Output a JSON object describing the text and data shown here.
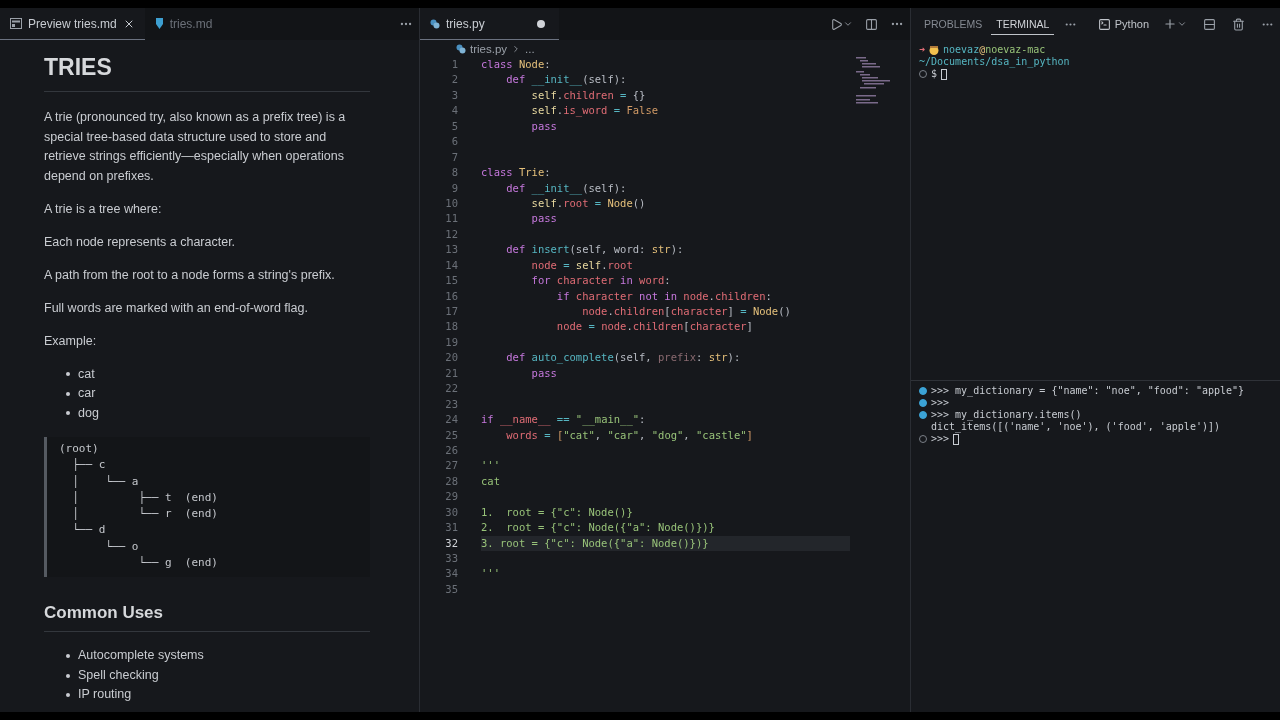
{
  "preview_tabs": [
    {
      "label": "Preview tries.md",
      "selected": true,
      "closable": true
    },
    {
      "label": "tries.md",
      "selected": false,
      "closable": false
    }
  ],
  "preview": {
    "blocks": [
      {
        "kind": "h1",
        "text": "TRIES"
      },
      {
        "kind": "p",
        "text": "A trie (pronounced try, also known as a prefix tree) is a special tree-based data structure used to store and retrieve strings efficiently—especially when operations depend on prefixes."
      },
      {
        "kind": "p",
        "text": "A trie is a tree where:"
      },
      {
        "kind": "p",
        "text": "Each node represents a character."
      },
      {
        "kind": "p",
        "text": "A path from the root to a node forms a string's prefix."
      },
      {
        "kind": "p",
        "text": "Full words are marked with an end-of-word flag."
      },
      {
        "kind": "p",
        "text": "Example:"
      },
      {
        "kind": "ul",
        "items": [
          "cat",
          "car",
          "dog"
        ]
      },
      {
        "kind": "pre",
        "lines": [
          "(root)",
          "  ├── c",
          "  │    └── a",
          "  │         ├── t  (end)",
          "  │         └── r  (end)",
          "  └── d",
          "       └── o",
          "            └── g  (end)"
        ]
      },
      {
        "kind": "h2",
        "text": "Common Uses"
      },
      {
        "kind": "ul",
        "items": [
          "Autocomplete systems",
          "Spell checking",
          "IP routing"
        ]
      }
    ]
  },
  "editor": {
    "tab": {
      "label": "tries.py",
      "modified": true,
      "selected": true
    },
    "breadcrumb": [
      "tries.py",
      "..."
    ],
    "lines": [
      {
        "n": "1",
        "selected": false,
        "tokens": [
          {
            "text": "class ",
            "kind": "kw"
          },
          {
            "text": "Node",
            "kind": "cls"
          },
          {
            "text": ":",
            "kind": "plain"
          }
        ]
      },
      {
        "n": "2",
        "selected": false,
        "tokens": [
          {
            "text": "    def ",
            "kind": "kw"
          },
          {
            "text": "__init__",
            "kind": "fn"
          },
          {
            "text": "(self):",
            "kind": "plain"
          }
        ]
      },
      {
        "n": "3",
        "selected": false,
        "tokens": [
          {
            "text": "        self",
            "kind": "self"
          },
          {
            "text": ".",
            "kind": "plain"
          },
          {
            "text": "children",
            "kind": "attr"
          },
          {
            "text": " = ",
            "kind": "op"
          },
          {
            "text": "{}",
            "kind": "plain"
          }
        ]
      },
      {
        "n": "4",
        "selected": false,
        "tokens": [
          {
            "text": "        self",
            "kind": "self"
          },
          {
            "text": ".",
            "kind": "plain"
          },
          {
            "text": "is_word",
            "kind": "attr"
          },
          {
            "text": " = ",
            "kind": "op"
          },
          {
            "text": "False",
            "kind": "num"
          }
        ]
      },
      {
        "n": "5",
        "selected": false,
        "tokens": [
          {
            "text": "        pass",
            "kind": "kw"
          }
        ]
      },
      {
        "n": "6",
        "selected": false
      },
      {
        "n": "7",
        "selected": false
      },
      {
        "n": "8",
        "selected": false,
        "tokens": [
          {
            "text": "class ",
            "kind": "kw"
          },
          {
            "text": "Trie",
            "kind": "cls"
          },
          {
            "text": ":",
            "kind": "plain"
          }
        ]
      },
      {
        "n": "9",
        "selected": false,
        "tokens": [
          {
            "text": "    def ",
            "kind": "kw"
          },
          {
            "text": "__init__",
            "kind": "fn"
          },
          {
            "text": "(self):",
            "kind": "plain"
          }
        ]
      },
      {
        "n": "10",
        "selected": false,
        "tokens": [
          {
            "text": "        self",
            "kind": "self"
          },
          {
            "text": ".",
            "kind": "plain"
          },
          {
            "text": "root",
            "kind": "attr"
          },
          {
            "text": " = ",
            "kind": "op"
          },
          {
            "text": "Node",
            "kind": "cls"
          },
          {
            "text": "()",
            "kind": "plain"
          }
        ]
      },
      {
        "n": "11",
        "selected": false,
        "tokens": [
          {
            "text": "        pass",
            "kind": "kw"
          }
        ]
      },
      {
        "n": "12",
        "selected": false
      },
      {
        "n": "13",
        "selected": false,
        "tokens": [
          {
            "text": "    def ",
            "kind": "kw"
          },
          {
            "text": "insert",
            "kind": "fn"
          },
          {
            "text": "(self, word: ",
            "kind": "plain"
          },
          {
            "text": "str",
            "kind": "cls"
          },
          {
            "text": "):",
            "kind": "plain"
          }
        ]
      },
      {
        "n": "14",
        "selected": false,
        "tokens": [
          {
            "text": "        node",
            "kind": "attr"
          },
          {
            "text": " = ",
            "kind": "op"
          },
          {
            "text": "self",
            "kind": "self"
          },
          {
            "text": ".",
            "kind": "plain"
          },
          {
            "text": "root",
            "kind": "attr"
          }
        ]
      },
      {
        "n": "15",
        "selected": false,
        "tokens": [
          {
            "text": "        for ",
            "kind": "kw"
          },
          {
            "text": "character",
            "kind": "attr"
          },
          {
            "text": " in ",
            "kind": "kw"
          },
          {
            "text": "word",
            "kind": "attr"
          },
          {
            "text": ":",
            "kind": "plain"
          }
        ]
      },
      {
        "n": "16",
        "selected": false,
        "tokens": [
          {
            "text": "            if ",
            "kind": "kw"
          },
          {
            "text": "character",
            "kind": "attr"
          },
          {
            "text": " not in ",
            "kind": "kw"
          },
          {
            "text": "node",
            "kind": "attr"
          },
          {
            "text": ".",
            "kind": "plain"
          },
          {
            "text": "children",
            "kind": "attr"
          },
          {
            "text": ":",
            "kind": "plain"
          }
        ]
      },
      {
        "n": "17",
        "selected": false,
        "tokens": [
          {
            "text": "                node",
            "kind": "attr"
          },
          {
            "text": ".",
            "kind": "plain"
          },
          {
            "text": "children",
            "kind": "attr"
          },
          {
            "text": "[",
            "kind": "plain"
          },
          {
            "text": "character",
            "kind": "attr"
          },
          {
            "text": "] ",
            "kind": "plain"
          },
          {
            "text": "= ",
            "kind": "op"
          },
          {
            "text": "Node",
            "kind": "cls"
          },
          {
            "text": "()",
            "kind": "plain"
          }
        ]
      },
      {
        "n": "18",
        "selected": false,
        "tokens": [
          {
            "text": "            node",
            "kind": "attr"
          },
          {
            "text": " = ",
            "kind": "op"
          },
          {
            "text": "node",
            "kind": "attr"
          },
          {
            "text": ".",
            "kind": "plain"
          },
          {
            "text": "children",
            "kind": "attr"
          },
          {
            "text": "[",
            "kind": "plain"
          },
          {
            "text": "character",
            "kind": "attr"
          },
          {
            "text": "]",
            "kind": "plain"
          }
        ]
      },
      {
        "n": "19",
        "selected": false
      },
      {
        "n": "20",
        "selected": false,
        "tokens": [
          {
            "text": "    def ",
            "kind": "kw"
          },
          {
            "text": "auto_complete",
            "kind": "fn"
          },
          {
            "text": "(self, ",
            "kind": "plain"
          },
          {
            "text": "prefix",
            "kind": "unused"
          },
          {
            "text": ": ",
            "kind": "plain"
          },
          {
            "text": "str",
            "kind": "cls"
          },
          {
            "text": "):",
            "kind": "plain"
          }
        ]
      },
      {
        "n": "21",
        "selected": false,
        "tokens": [
          {
            "text": "        pass",
            "kind": "kw"
          }
        ]
      },
      {
        "n": "22",
        "selected": false
      },
      {
        "n": "23",
        "selected": false
      },
      {
        "n": "24",
        "selected": false,
        "tokens": [
          {
            "text": "if ",
            "kind": "kw"
          },
          {
            "text": "__name__",
            "kind": "attr"
          },
          {
            "text": " == ",
            "kind": "op"
          },
          {
            "text": "\"__main__\"",
            "kind": "str"
          },
          {
            "text": ":",
            "kind": "plain"
          }
        ]
      },
      {
        "n": "25",
        "selected": false,
        "tokens": [
          {
            "text": "    words",
            "kind": "attr"
          },
          {
            "text": " = ",
            "kind": "op"
          },
          {
            "text": "[",
            "kind": "num"
          },
          {
            "text": "\"cat\"",
            "kind": "str"
          },
          {
            "text": ", ",
            "kind": "plain"
          },
          {
            "text": "\"car\"",
            "kind": "str"
          },
          {
            "text": ", ",
            "kind": "plain"
          },
          {
            "text": "\"dog\"",
            "kind": "str"
          },
          {
            "text": ", ",
            "kind": "plain"
          },
          {
            "text": "\"castle\"",
            "kind": "str"
          },
          {
            "text": "]",
            "kind": "num"
          }
        ]
      },
      {
        "n": "26",
        "selected": false
      },
      {
        "n": "27",
        "selected": false,
        "tokens": [
          {
            "text": "'''",
            "kind": "str"
          }
        ]
      },
      {
        "n": "28",
        "selected": false,
        "tokens": [
          {
            "text": "cat",
            "kind": "str"
          }
        ]
      },
      {
        "n": "29",
        "selected": false
      },
      {
        "n": "30",
        "selected": false,
        "tokens": [
          {
            "text": "1.  root = {\"c\": Node()}",
            "kind": "str"
          }
        ]
      },
      {
        "n": "31",
        "selected": false,
        "tokens": [
          {
            "text": "2.  root = {\"c\": Node({\"a\": Node()})}",
            "kind": "str"
          }
        ]
      },
      {
        "n": "32",
        "selected": true,
        "tokens": [
          {
            "text": "3. root = {\"c\": Node({\"a\": Node()})}",
            "kind": "str"
          }
        ]
      },
      {
        "n": "33",
        "selected": false
      },
      {
        "n": "34",
        "selected": false,
        "tokens": [
          {
            "text": "'''",
            "kind": "str"
          }
        ]
      },
      {
        "n": "35",
        "selected": false
      }
    ]
  },
  "panel": {
    "tabs": [
      {
        "label": "PROBLEMS",
        "selected": false
      },
      {
        "label": "TERMINAL",
        "selected": true
      }
    ],
    "terminal_name": "Python",
    "shell": {
      "arrow": "➜",
      "user": "noevaz",
      "at": "@",
      "host": "noevaz-mac",
      "cwd": "~/Documents/dsa_in_python",
      "prompt": "$"
    },
    "repl": [
      {
        "kind": "filled",
        "text": ">>> my_dictionary = {\"name\": \"noe\", \"food\": \"apple\"}"
      },
      {
        "kind": "filled",
        "text": ">>>"
      },
      {
        "kind": "filled",
        "text": ">>> my_dictionary.items()"
      },
      {
        "kind": "output",
        "text": "dict_items([('name', 'noe'), ('food', 'apple')])"
      },
      {
        "kind": "hollow",
        "text": ">>>",
        "cursor": true
      }
    ]
  }
}
